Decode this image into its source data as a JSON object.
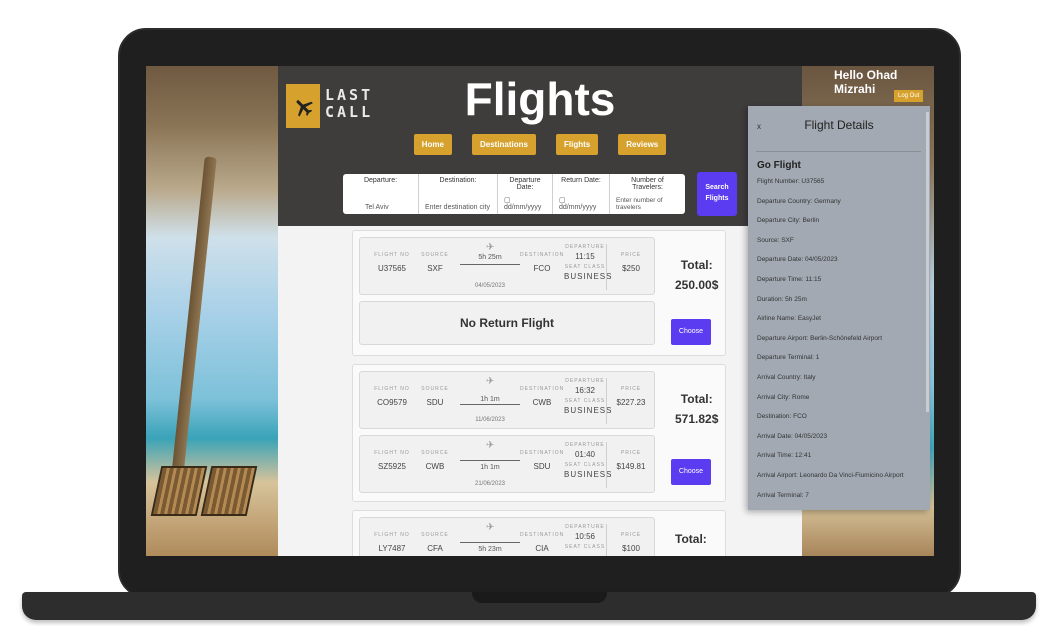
{
  "app": {
    "logo_line1": "LAST",
    "logo_line2": "CALL",
    "title": "Flights"
  },
  "user": {
    "greeting": "Hello Ohad Mizrahi",
    "logout_label": "Log Out"
  },
  "nav": [
    "Home",
    "Destinations",
    "Flights",
    "Reviews"
  ],
  "search": {
    "departure_label": "Departure:",
    "departure_value": "Tel Aviv",
    "destination_label": "Destination:",
    "destination_placeholder": "Enter destination city",
    "departure_date_label": "Departure Date:",
    "departure_date_value": "dd/mm/yyyy",
    "return_date_label": "Return Date:",
    "return_date_value": "dd/mm/yyyy",
    "travelers_label": "Number of Travelers:",
    "travelers_placeholder": "Enter number of travelers",
    "button_line1": "Search",
    "button_line2": "Flights"
  },
  "captions": {
    "flight_no": "FLIGHT NO",
    "source": "SOURCE",
    "destination": "DESTINATION",
    "departure": "DEPARTURE",
    "seat_class": "SEAT CLASS",
    "price": "PRICE"
  },
  "results": [
    {
      "total_label": "Total:",
      "total_value": "250.00$",
      "outbound": {
        "flight_no": "U37565",
        "source": "SXF",
        "duration": "5h 25m",
        "date": "04/05/2023",
        "destination": "FCO",
        "departure_time": "11:15",
        "seat_class": "BUSINESS",
        "price": "$250"
      },
      "return_text": "No Return Flight",
      "choose_label": "Choose"
    },
    {
      "total_label": "Total:",
      "total_value": "571.82$",
      "outbound": {
        "flight_no": "CO9579",
        "source": "SDU",
        "duration": "1h 1m",
        "date": "11/06/2023",
        "destination": "CWB",
        "departure_time": "16:32",
        "seat_class": "BUSINESS",
        "price": "$227.23"
      },
      "inbound": {
        "flight_no": "SZ5925",
        "source": "CWB",
        "duration": "1h 1m",
        "date": "21/06/2023",
        "destination": "SDU",
        "departure_time": "01:40",
        "seat_class": "BUSINESS",
        "price": "$149.81"
      },
      "choose_label": "Choose"
    },
    {
      "total_label": "Total:",
      "outbound": {
        "flight_no": "LY7487",
        "source": "CFA",
        "duration": "5h 23m",
        "destination": "CIA",
        "departure_time": "10:56",
        "price": "$100"
      }
    }
  ],
  "details": {
    "close": "x",
    "title": "Flight Details",
    "airline": "Go Flight",
    "rows": [
      "Flight Number: U37565",
      "Departure Country: Germany",
      "Departure City: Berlin",
      "Source: SXF",
      "Departure Date: 04/05/2023",
      "Departure Time: 11:15",
      "Duration: 5h 25m",
      "Airline Name: EasyJet",
      "Departure Airport: Berlin-Schönefeld Airport",
      "Departure Terminal: 1",
      "Arrival Country: Italy",
      "Arrival City: Rome",
      "Destination: FCO",
      "Arrival Date: 04/05/2023",
      "Arrival Time: 12:41",
      "Arrival Airport: Leonardo Da Vinci-Fiumicino Airport",
      "Arrival Terminal: 7"
    ]
  },
  "colors": {
    "accent": "#d6a12c",
    "primary": "#5b3cf0",
    "header": "#3f3c3c",
    "panel": "#a2a9b2"
  }
}
